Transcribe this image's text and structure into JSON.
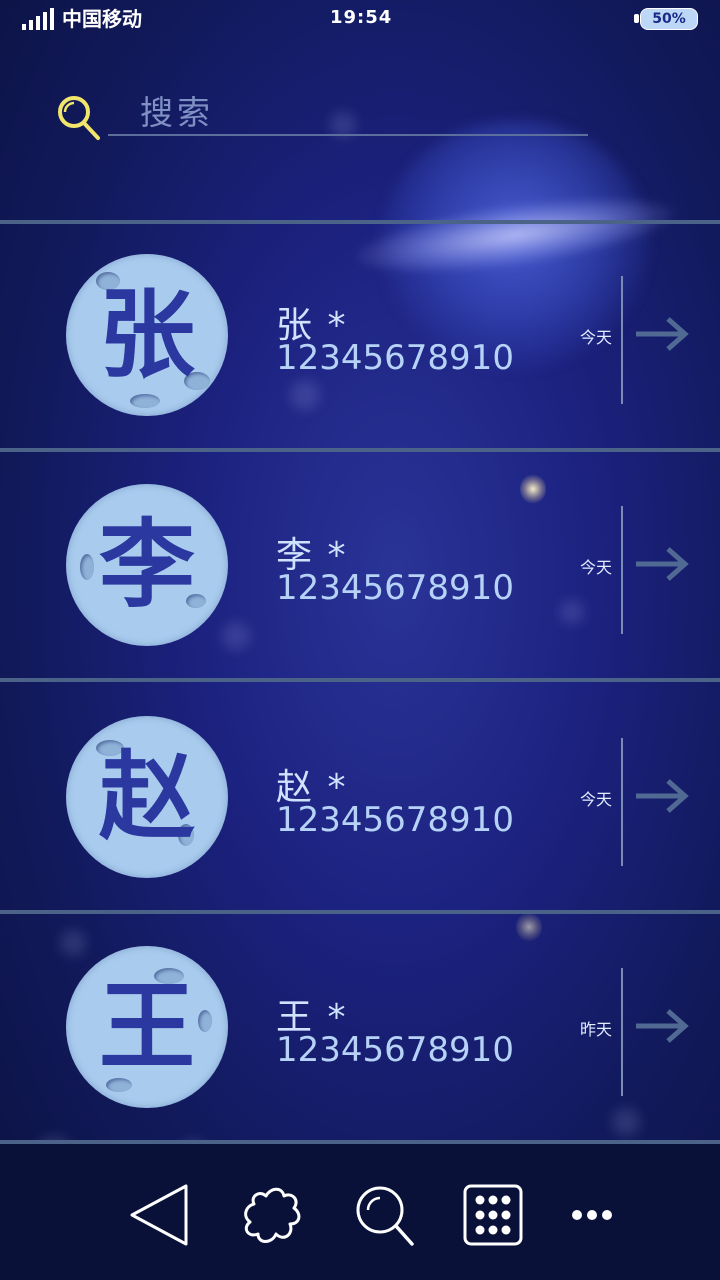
{
  "status_bar": {
    "carrier": "中国移动",
    "time": "19:54",
    "battery": "50%"
  },
  "search": {
    "placeholder": "搜索"
  },
  "contacts": [
    {
      "avatar_char": "张",
      "name": "张 *",
      "phone": "12345678910",
      "date": "今天"
    },
    {
      "avatar_char": "李",
      "name": "李 *",
      "phone": "12345678910",
      "date": "今天"
    },
    {
      "avatar_char": "赵",
      "name": "赵 *",
      "phone": "12345678910",
      "date": "今天"
    },
    {
      "avatar_char": "王",
      "name": "王 *",
      "phone": "12345678910",
      "date": "昨天"
    }
  ],
  "bottom_nav": {
    "icons": [
      "back-icon",
      "puzzle-icon",
      "search-icon",
      "apps-grid-icon",
      "more-icon"
    ]
  },
  "colors": {
    "background": "#1c2280",
    "accent_search_icon": "#f2e56b",
    "avatar_fill": "#a9ccee",
    "avatar_text": "#2b38a0",
    "divider": "#4b6389"
  }
}
